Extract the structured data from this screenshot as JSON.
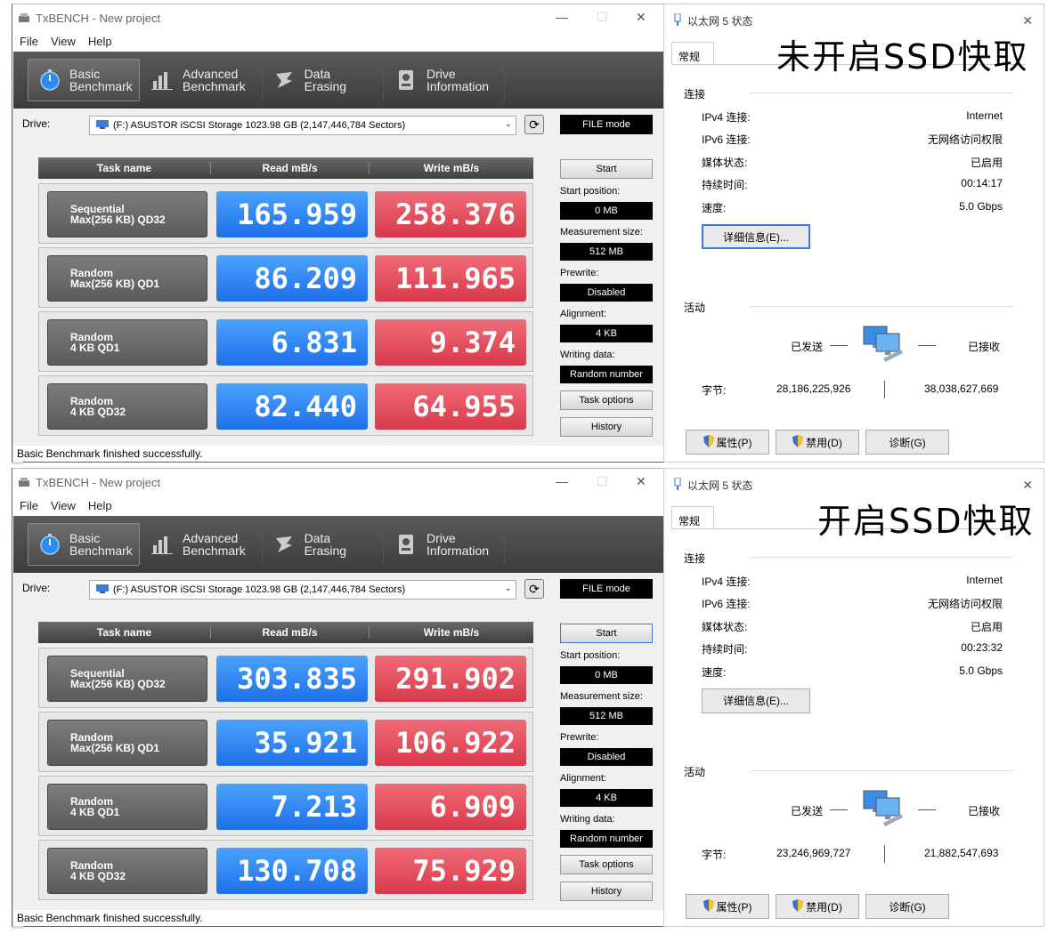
{
  "panels": [
    {
      "app_title": "TxBENCH - New project",
      "menu": [
        "File",
        "View",
        "Help"
      ],
      "tabs": [
        "Basic\nBenchmark",
        "Advanced\nBenchmark",
        "Data Erasing",
        "Drive\nInformation"
      ],
      "drive_label": "Drive:",
      "drive_value": "(F:) ASUSTOR iSCSI Storage  1023.98 GB (2,147,446,784 Sectors)",
      "file_mode": "FILE mode",
      "headers": [
        "Task name",
        "Read mB/s",
        "Write mB/s"
      ],
      "rows": [
        {
          "name1": "Sequential",
          "name2": "Max(256 KB) QD32",
          "read": "165.959",
          "write": "258.376"
        },
        {
          "name1": "Random",
          "name2": "Max(256 KB) QD1",
          "read": "86.209",
          "write": "111.965"
        },
        {
          "name1": "Random",
          "name2": "4 KB QD1",
          "read": "6.831",
          "write": "9.374"
        },
        {
          "name1": "Random",
          "name2": "4 KB QD32",
          "read": "82.440",
          "write": "64.955"
        }
      ],
      "start_label": "Start",
      "start_position_label": "Start position:",
      "start_position": "0 MB",
      "measurement_label": "Measurement size:",
      "measurement": "512 MB",
      "prewrite_label": "Prewrite:",
      "prewrite": "Disabled",
      "alignment_label": "Alignment:",
      "alignment": "4 KB",
      "writing_label": "Writing data:",
      "writing": "Random number",
      "task_options": "Task options",
      "history": "History",
      "status": "Basic Benchmark finished successfully.",
      "net": {
        "title": "以太网 5 状态",
        "tab": "常规",
        "overlay": "未开启SSD快取",
        "connection_label": "连接",
        "kv": [
          {
            "k": "IPv4 连接:",
            "v": "Internet"
          },
          {
            "k": "IPv6 连接:",
            "v": "无网络访问权限"
          },
          {
            "k": "媒体状态:",
            "v": "已启用"
          },
          {
            "k": "持续时间:",
            "v": "00:14:17"
          },
          {
            "k": "速度:",
            "v": "5.0 Gbps"
          }
        ],
        "details_btn": "详细信息(E)...",
        "activity_label": "活动",
        "sent_label": "已发送",
        "recv_label": "已接收",
        "bytes_label": "字节:",
        "bytes_sent": "28,186,225,926",
        "bytes_recv": "38,038,627,669",
        "btn_props": "属性(P)",
        "btn_disable": "禁用(D)",
        "btn_diag": "诊断(G)"
      }
    },
    {
      "app_title": "TxBENCH - New project",
      "menu": [
        "File",
        "View",
        "Help"
      ],
      "tabs": [
        "Basic\nBenchmark",
        "Advanced\nBenchmark",
        "Data Erasing",
        "Drive\nInformation"
      ],
      "drive_label": "Drive:",
      "drive_value": "(F:) ASUSTOR iSCSI Storage  1023.98 GB (2,147,446,784 Sectors)",
      "file_mode": "FILE mode",
      "headers": [
        "Task name",
        "Read mB/s",
        "Write mB/s"
      ],
      "rows": [
        {
          "name1": "Sequential",
          "name2": "Max(256 KB) QD32",
          "read": "303.835",
          "write": "291.902"
        },
        {
          "name1": "Random",
          "name2": "Max(256 KB) QD1",
          "read": "35.921",
          "write": "106.922"
        },
        {
          "name1": "Random",
          "name2": "4 KB QD1",
          "read": "7.213",
          "write": "6.909"
        },
        {
          "name1": "Random",
          "name2": "4 KB QD32",
          "read": "130.708",
          "write": "75.929"
        }
      ],
      "start_label": "Start",
      "start_position_label": "Start position:",
      "start_position": "0 MB",
      "measurement_label": "Measurement size:",
      "measurement": "512 MB",
      "prewrite_label": "Prewrite:",
      "prewrite": "Disabled",
      "alignment_label": "Alignment:",
      "alignment": "4 KB",
      "writing_label": "Writing data:",
      "writing": "Random number",
      "task_options": "Task options",
      "history": "History",
      "status": "Basic Benchmark finished successfully.",
      "net": {
        "title": "以太网 5 状态",
        "tab": "常规",
        "overlay": "开启SSD快取",
        "connection_label": "连接",
        "kv": [
          {
            "k": "IPv4 连接:",
            "v": "Internet"
          },
          {
            "k": "IPv6 连接:",
            "v": "无网络访问权限"
          },
          {
            "k": "媒体状态:",
            "v": "已启用"
          },
          {
            "k": "持续时间:",
            "v": "00:23:32"
          },
          {
            "k": "速度:",
            "v": "5.0 Gbps"
          }
        ],
        "details_btn": "详细信息(E)...",
        "activity_label": "活动",
        "sent_label": "已发送",
        "recv_label": "已接收",
        "bytes_label": "字节:",
        "bytes_sent": "23,246,969,727",
        "bytes_recv": "21,882,547,693",
        "btn_props": "属性(P)",
        "btn_disable": "禁用(D)",
        "btn_diag": "诊断(G)"
      }
    }
  ]
}
